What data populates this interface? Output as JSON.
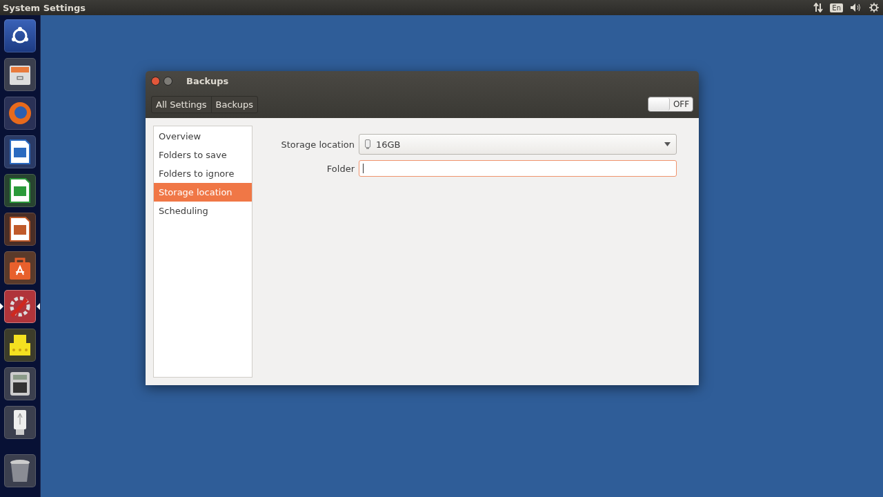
{
  "top_bar": {
    "title": "System Settings",
    "keyboard_layout": "En"
  },
  "launcher": [
    {
      "kind": "dash",
      "active": false
    },
    {
      "kind": "files",
      "active": false
    },
    {
      "kind": "browser",
      "active": false
    },
    {
      "kind": "writer",
      "active": false
    },
    {
      "kind": "calc",
      "active": false
    },
    {
      "kind": "impress",
      "active": false
    },
    {
      "kind": "store",
      "active": false
    },
    {
      "kind": "settings",
      "active": true
    },
    {
      "kind": "archive",
      "active": false
    },
    {
      "kind": "calculator",
      "active": false
    },
    {
      "kind": "usb",
      "active": false
    },
    {
      "kind": "trash",
      "active": false
    }
  ],
  "window": {
    "title": "Backups",
    "breadcrumbs": [
      "All Settings",
      "Backups"
    ],
    "toggle": {
      "label": "OFF",
      "on": false
    },
    "sidebar": {
      "items": [
        {
          "label": "Overview",
          "selected": false
        },
        {
          "label": "Folders to save",
          "selected": false
        },
        {
          "label": "Folders to ignore",
          "selected": false
        },
        {
          "label": "Storage location",
          "selected": true
        },
        {
          "label": "Scheduling",
          "selected": false
        }
      ]
    },
    "form": {
      "storage_label": "Storage location",
      "storage_value": "16GB",
      "folder_label": "Folder",
      "folder_focused": true
    }
  }
}
